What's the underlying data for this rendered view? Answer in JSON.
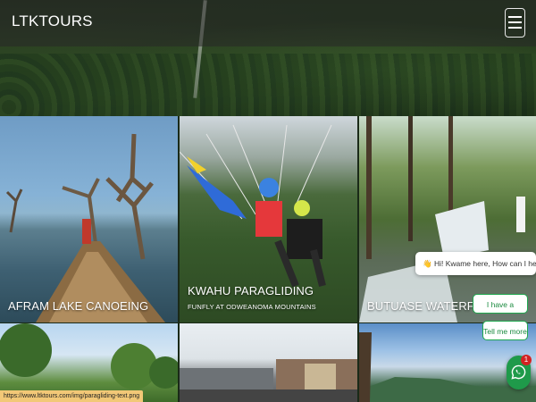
{
  "nav": {
    "brand": "LTKTOURS",
    "menu_icon": "hamburger-menu-icon"
  },
  "tiles": [
    {
      "title": "AFRAM LAKE CANOEING",
      "subtitle": ""
    },
    {
      "title": "KWAHU PARAGLIDING",
      "subtitle": "FUNFLY AT ODWEANOMA MOUNTAINS"
    },
    {
      "title": "BUTUASE WATERFALL",
      "subtitle": ""
    },
    {
      "title": "",
      "subtitle": ""
    },
    {
      "title": "",
      "subtitle": ""
    },
    {
      "title": "",
      "subtitle": ""
    }
  ],
  "chat": {
    "greeting": "👋 Hi! Kwame here, How can I help?",
    "buttons": [
      "I have a question",
      "Tell me more"
    ],
    "badge_count": "1",
    "icon": "whatsapp-chat-icon"
  },
  "status_bar": {
    "url": "https://www.ltktours.com/img/paragliding-text.png"
  },
  "colors": {
    "chat_green": "#1f9a4a",
    "badge_red": "#d32222",
    "status_bg": "#f2c877"
  }
}
